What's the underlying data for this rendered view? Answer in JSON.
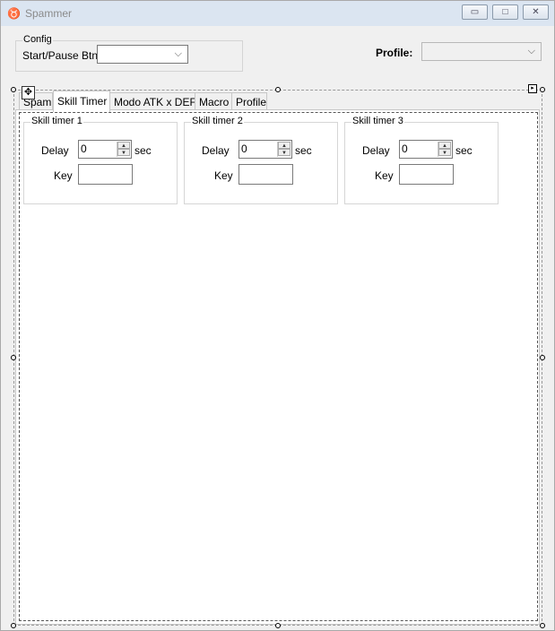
{
  "window": {
    "title": "Spammer",
    "app_icon": "spammer-icon"
  },
  "controls": {
    "minimize": "▭",
    "maximize": "□",
    "close": "✕"
  },
  "config": {
    "legend": "Config",
    "start_pause_label": "Start/Pause Btn",
    "start_pause_value": ""
  },
  "profile": {
    "label": "Profile:",
    "value": ""
  },
  "tabs": [
    {
      "label": "Spam"
    },
    {
      "label": "Skill Timer"
    },
    {
      "label": "Modo ATK x DEF"
    },
    {
      "label": "Macro"
    },
    {
      "label": "Profile"
    }
  ],
  "skill_timers": [
    {
      "legend": "Skill timer 1",
      "delay_label": "Delay",
      "delay_value": "0",
      "unit": "sec",
      "key_label": "Key",
      "key_value": ""
    },
    {
      "legend": "Skill timer 2",
      "delay_label": "Delay",
      "delay_value": "0",
      "unit": "sec",
      "key_label": "Key",
      "key_value": ""
    },
    {
      "legend": "Skill timer 3",
      "delay_label": "Delay",
      "delay_value": "0",
      "unit": "sec",
      "key_label": "Key",
      "key_value": ""
    }
  ],
  "designer": {
    "move_glyph": "✥",
    "smart_tag_glyph": "▸"
  }
}
